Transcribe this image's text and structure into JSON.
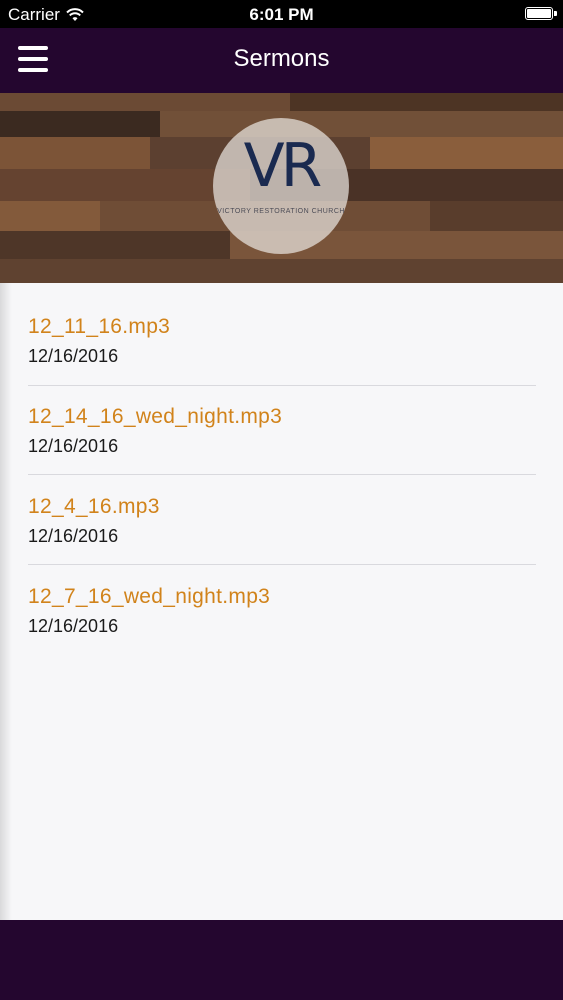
{
  "status_bar": {
    "carrier": "Carrier",
    "time": "6:01 PM"
  },
  "nav": {
    "title": "Sermons"
  },
  "banner": {
    "logo_mark": "VR",
    "logo_text": "VICTORY RESTORATION CHURCH"
  },
  "sermons": [
    {
      "title": "12_11_16.mp3",
      "date": "12/16/2016"
    },
    {
      "title": "12_14_16_wed_night.mp3",
      "date": "12/16/2016"
    },
    {
      "title": "12_4_16.mp3",
      "date": "12/16/2016"
    },
    {
      "title": "12_7_16_wed_night.mp3",
      "date": "12/16/2016"
    }
  ],
  "colors": {
    "accent": "#d1831b",
    "nav_background": "#24062f",
    "list_background": "#f7f7f9"
  }
}
